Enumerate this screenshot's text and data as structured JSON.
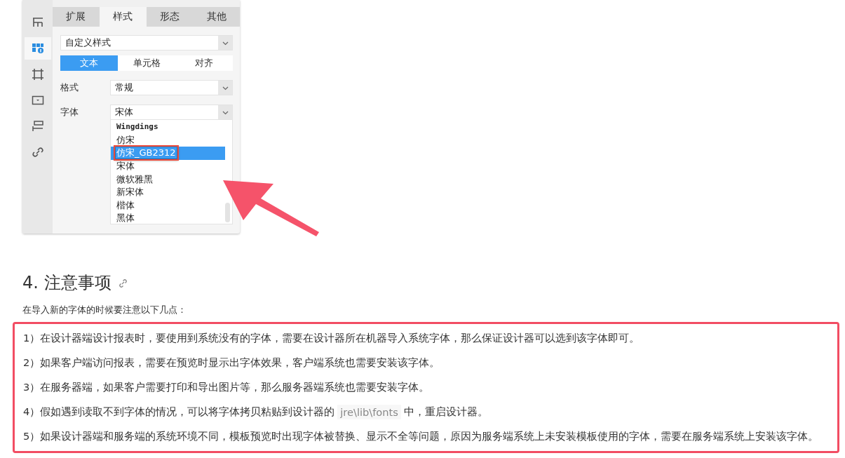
{
  "panel": {
    "side_icons": [
      {
        "selected": false
      },
      {
        "selected": true
      },
      {
        "selected": false
      },
      {
        "selected": false
      },
      {
        "selected": false
      },
      {
        "selected": false
      }
    ],
    "tabs": [
      {
        "label": "扩展",
        "selected": false
      },
      {
        "label": "样式",
        "selected": true
      },
      {
        "label": "形态",
        "selected": false
      },
      {
        "label": "其他",
        "selected": false
      }
    ],
    "style_select": {
      "value": "自定义样式"
    },
    "sub_tabs": [
      {
        "label": "文本",
        "selected": true
      },
      {
        "label": "单元格",
        "selected": false
      },
      {
        "label": "对齐",
        "selected": false
      }
    ],
    "fields": [
      {
        "label": "格式",
        "value": "常规"
      },
      {
        "label": "字体",
        "value": "宋体"
      }
    ],
    "font_list": [
      {
        "label": "Wingdings",
        "kind": "symbol",
        "selected": false,
        "outlined": false
      },
      {
        "label": "仿宋",
        "kind": "plain",
        "selected": false,
        "outlined": false
      },
      {
        "label": "仿宋_GB2312",
        "kind": "plain",
        "selected": true,
        "outlined": true
      },
      {
        "label": "宋体",
        "kind": "plain",
        "selected": false,
        "outlined": false
      },
      {
        "label": "微软雅黑",
        "kind": "plain",
        "selected": false,
        "outlined": false
      },
      {
        "label": "新宋体",
        "kind": "plain",
        "selected": false,
        "outlined": false
      },
      {
        "label": "楷体",
        "kind": "plain",
        "selected": false,
        "outlined": false
      },
      {
        "label": "黑体",
        "kind": "plain",
        "selected": false,
        "outlined": false
      }
    ]
  },
  "heading": "4. 注意事项",
  "intro": "在导入新的字体的时候要注意以下几点：",
  "notes": {
    "outlined": true,
    "items": [
      {
        "parts": [
          {
            "kind": "text",
            "text": "1）在设计器端设计报表时，要使用到系统没有的字体，需要在设计器所在机器导入系统字体，那么保证设计器可以选到该字体即可。"
          }
        ]
      },
      {
        "parts": [
          {
            "kind": "text",
            "text": "2）如果客户端访问报表，需要在预览时显示出字体效果，客户端系统也需要安装该字体。"
          }
        ]
      },
      {
        "parts": [
          {
            "kind": "text",
            "text": "3）在服务器端，如果客户需要打印和导出图片等，那么服务器端系统也需要安装字体。"
          }
        ]
      },
      {
        "parts": [
          {
            "kind": "text",
            "text": "4）假如遇到读取不到字体的情况，可以将字体拷贝粘贴到设计器的"
          },
          {
            "kind": "code",
            "text": "jre\\lib\\fonts"
          },
          {
            "kind": "text",
            "text": "中，重启设计器。"
          }
        ]
      },
      {
        "parts": [
          {
            "kind": "text",
            "text": "5）如果设计器端和服务端的系统环境不同，模板预览时出现字体被替换、显示不全等问题，原因为服务端系统上未安装模板使用的字体，需要在服务端系统上安装该字体。"
          }
        ]
      }
    ]
  }
}
